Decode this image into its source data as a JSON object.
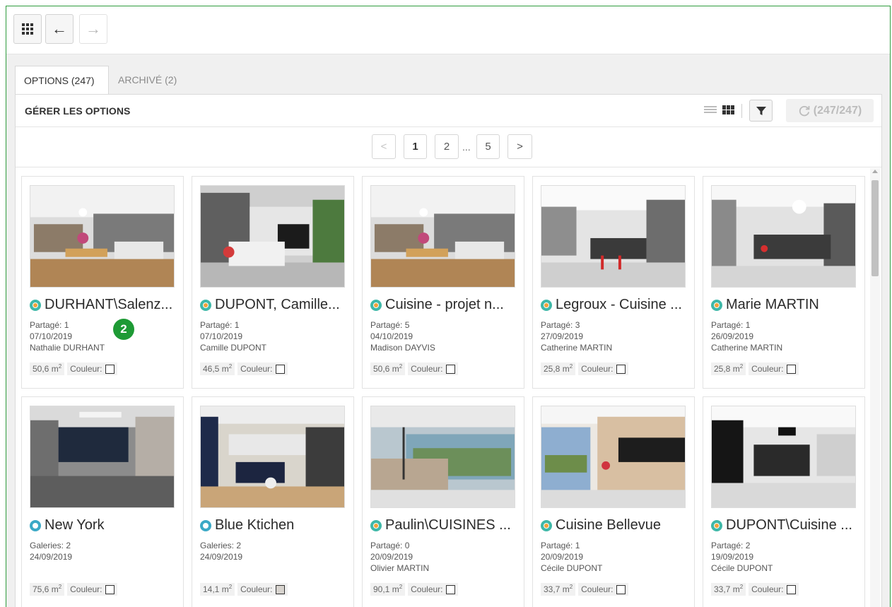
{
  "toolbar": {
    "apps_icon": "grid-icon",
    "back_symbol": "←",
    "forward_symbol": "→"
  },
  "tabs": [
    {
      "label": "OPTIONS (247)",
      "active": true
    },
    {
      "label": "ARCHIVÉ (2)",
      "active": false
    }
  ],
  "panel": {
    "title": "GÉRER LES OPTIONS",
    "refresh_label": "(247/247)"
  },
  "pagination": {
    "prev": "<",
    "pages": [
      "1",
      "2",
      "5"
    ],
    "ellipsis": "...",
    "next": ">",
    "current": "1"
  },
  "step_badge": "2",
  "accent_color": "#2e9b3d",
  "cards": [
    {
      "title": "DURHANT\\Salenz...",
      "badge": "shared",
      "lines": [
        "Partagé: 1",
        "07/10/2019",
        "Nathalie DURHANT"
      ],
      "area": "50,6 m",
      "color_label": "Couleur:",
      "swatch": "#ffffff"
    },
    {
      "title": "DUPONT, Camille...",
      "badge": "shared",
      "lines": [
        "Partagé: 1",
        "07/10/2019",
        "Camille DUPONT"
      ],
      "area": "46,5 m",
      "color_label": "Couleur:",
      "swatch": "#ffffff"
    },
    {
      "title": "Cuisine - projet n...",
      "badge": "shared",
      "lines": [
        "Partagé: 5",
        "04/10/2019",
        "Madison DAYVIS"
      ],
      "area": "50,6 m",
      "color_label": "Couleur:",
      "swatch": "#ffffff"
    },
    {
      "title": "Legroux - Cuisine ...",
      "badge": "shared",
      "lines": [
        "Partagé: 3",
        "27/09/2019",
        "Catherine MARTIN"
      ],
      "area": "25,8 m",
      "color_label": "Couleur:",
      "swatch": "#ffffff"
    },
    {
      "title": "Marie MARTIN",
      "badge": "shared",
      "lines": [
        "Partagé: 1",
        "26/09/2019",
        "Catherine MARTIN"
      ],
      "area": "25,8 m",
      "color_label": "Couleur:",
      "swatch": "#ffffff"
    },
    {
      "title": "New York",
      "badge": "gallery",
      "lines": [
        "Galeries: 2",
        "24/09/2019",
        ""
      ],
      "area": "75,6 m",
      "color_label": "Couleur:",
      "swatch": "#ffffff"
    },
    {
      "title": "Blue Ktichen",
      "badge": "gallery",
      "lines": [
        "Galeries: 2",
        "24/09/2019",
        ""
      ],
      "area": "14,1 m",
      "color_label": "Couleur:",
      "swatch": "#d8d4cf"
    },
    {
      "title": "Paulin\\CUISINES ...",
      "badge": "shared",
      "lines": [
        "Partagé: 0",
        "20/09/2019",
        "Olivier MARTIN"
      ],
      "area": "90,1 m",
      "color_label": "Couleur:",
      "swatch": "#ffffff"
    },
    {
      "title": "Cuisine Bellevue",
      "badge": "shared",
      "lines": [
        "Partagé: 1",
        "20/09/2019",
        "Cécile DUPONT"
      ],
      "area": "33,7 m",
      "color_label": "Couleur:",
      "swatch": "#ffffff"
    },
    {
      "title": "DUPONT\\Cuisine ...",
      "badge": "shared",
      "lines": [
        "Partagé: 2",
        "19/09/2019",
        "Cécile DUPONT"
      ],
      "area": "33,7 m",
      "color_label": "Couleur:",
      "swatch": "#ffffff"
    }
  ],
  "unit_exponent": "2"
}
